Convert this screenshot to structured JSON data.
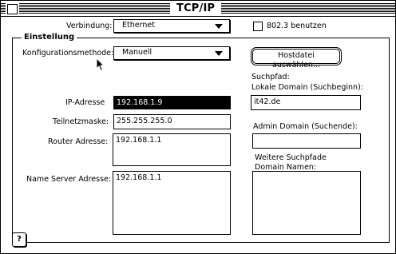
{
  "window": {
    "title": "TCP/IP"
  },
  "verbindung": {
    "label": "Verbindung:",
    "value": "Ethernet"
  },
  "checkbox_8023": {
    "label": "802.3 benutzen",
    "checked": false
  },
  "einstellung": {
    "group_title": "Einstellung"
  },
  "konfiguration": {
    "label": "Konfigurationsmethode:",
    "value": "Manuell"
  },
  "hostfile_button": {
    "label": "Hostdatei auswählen..."
  },
  "suchpfad": {
    "label1": "Suchpfad:",
    "label2": "Lokale Domain (Suchbeginn):",
    "value": "it42.de"
  },
  "ip": {
    "label": "IP-Adresse",
    "value": "192.168.1.9"
  },
  "subnet": {
    "label": "Teilnetzmaske:",
    "value": "255.255.255.0"
  },
  "router": {
    "label": "Router Adresse:",
    "value": "192.168.1.1"
  },
  "admin_domain": {
    "label": "Admin Domain (Suchende):",
    "value": ""
  },
  "nameserver": {
    "label": "Name Server Adresse:",
    "value": "192.168.1.1"
  },
  "weitere": {
    "label1": "Weitere Suchpfade",
    "label2": "Domain Namen:",
    "value": ""
  },
  "help": {
    "icon": "help-icon",
    "glyph": "?"
  }
}
